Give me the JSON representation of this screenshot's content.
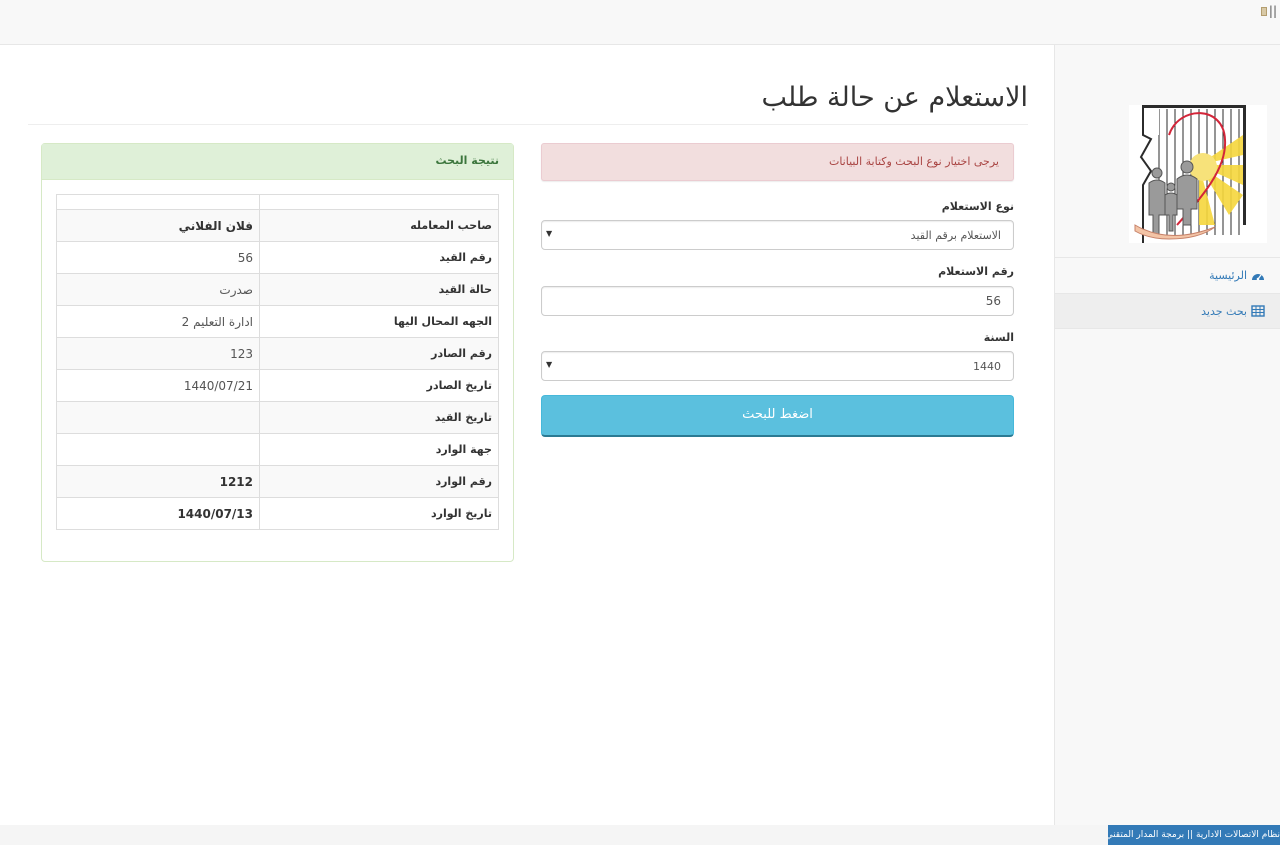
{
  "topbar": {
    "toggle_text": "||"
  },
  "sidebar": {
    "logo": "logo-icon",
    "items": [
      {
        "label": "الرئيسية",
        "icon": "dashboard-icon",
        "active": false
      },
      {
        "label": "بحث جديد",
        "icon": "table-icon",
        "active": true
      }
    ]
  },
  "page": {
    "title": "الاستعلام عن حالة طلب"
  },
  "form": {
    "alert": "يرجى اختيار نوع البحث وكتابة البيانات",
    "type_label": "نوع الاستعلام",
    "type_value": "الاستعلام برقم القيد",
    "number_label": "رقم الاستعلام",
    "number_value": "56",
    "year_label": "السنة",
    "year_value": "1440",
    "submit_label": "اضغط للبحث"
  },
  "results": {
    "heading": "نتيجة البحث",
    "rows": [
      {
        "key": "صاحب المعامله",
        "value": "فلان الفلاني"
      },
      {
        "key": "رقم القيد",
        "value": "56"
      },
      {
        "key": "حالة القيد",
        "value": "صدرت"
      },
      {
        "key": "الجهه المحال اليها",
        "value": "ادارة التعليم 2"
      },
      {
        "key": "رقم الصادر",
        "value": "123"
      },
      {
        "key": "تاريخ الصادر",
        "value": "1440/07/21"
      },
      {
        "key": "تاريخ القيد",
        "value": ""
      },
      {
        "key": "جهة الوارد",
        "value": ""
      },
      {
        "key": "رقم الوارد",
        "value": "1212"
      },
      {
        "key": "تاريخ الوارد",
        "value": "1440/07/13"
      }
    ]
  },
  "footer": {
    "badge": "نظام الاتصالات الادارية || برمجة المدار المتقني"
  },
  "colors": {
    "alert_bg": "#f2dede",
    "alert_text": "#a94442",
    "panel_heading_bg": "#dff0d8",
    "panel_heading_text": "#3c763d",
    "button_bg": "#5bc0de",
    "link": "#337ab7"
  }
}
